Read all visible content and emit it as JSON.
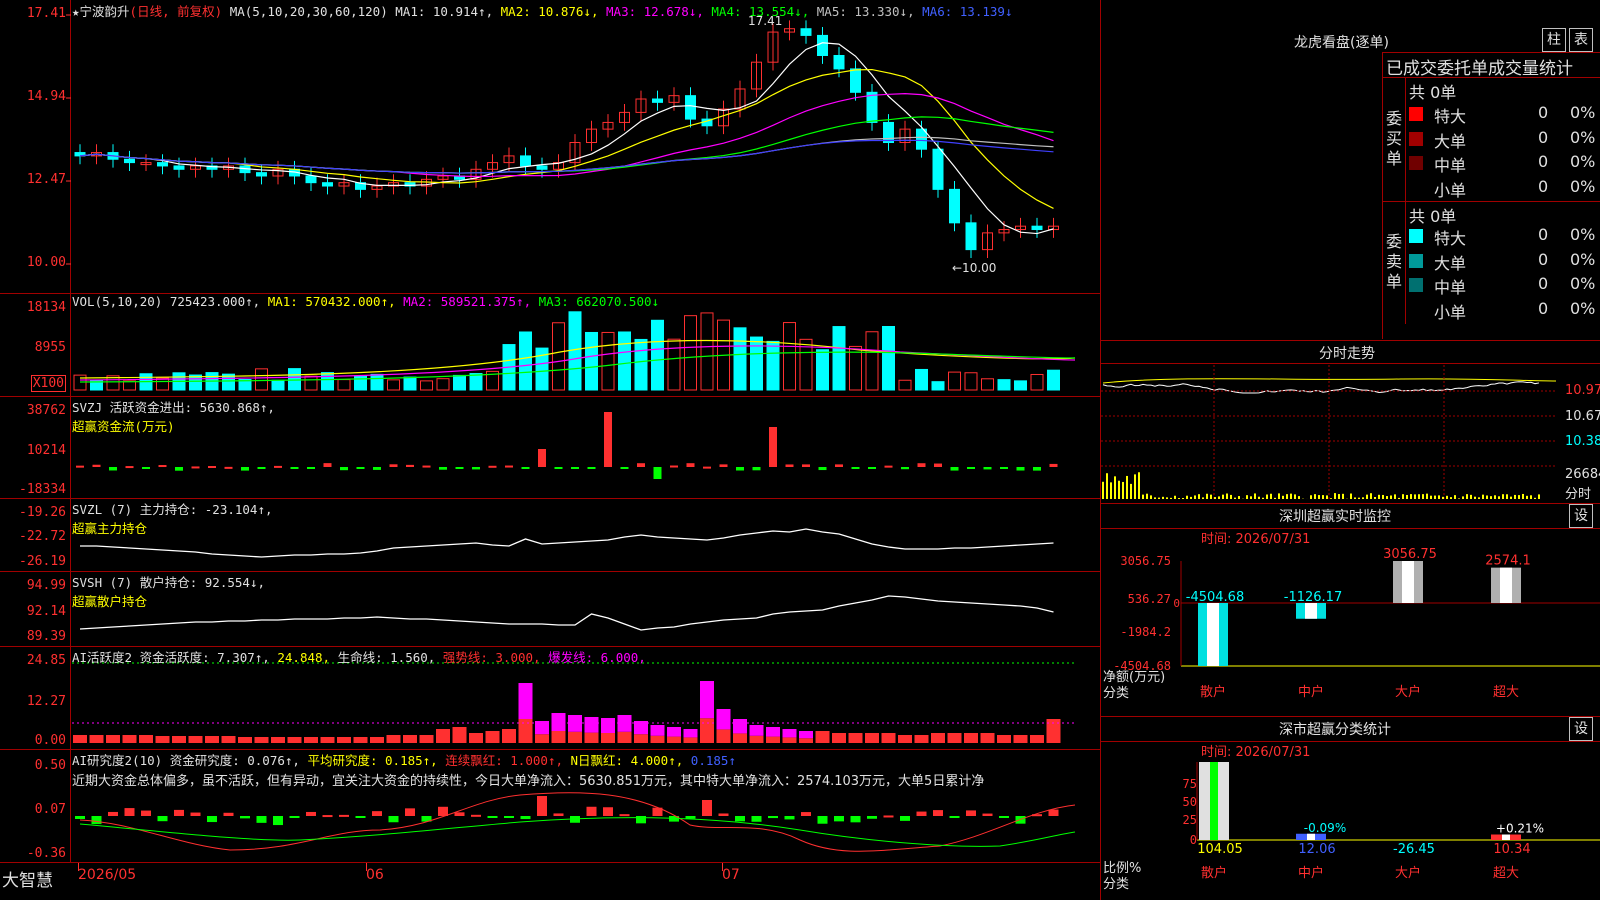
{
  "stock": {
    "star": "★",
    "name": "宁波韵升",
    "period": "(日线, 前复权)"
  },
  "main_head": {
    "ma_params": "MA(5,10,20,30,60,120)",
    "ma1": "MA1: 10.914↑,",
    "ma2": "MA2: 10.876↓,",
    "ma3": "MA3: 12.678↓,",
    "ma4": "MA4: 13.554↓,",
    "ma5": "MA5: 13.330↓,",
    "ma6": "MA6: 13.139↓"
  },
  "price_axis": [
    "17.41",
    "14.94",
    "12.47",
    "10.00"
  ],
  "price_marks": {
    "high": "17.41",
    "low": "←10.00"
  },
  "vol_head": {
    "params": "VOL(5,10,20)",
    "vol": "725423.000↑,",
    "ma1": "MA1: 570432.000↑,",
    "ma2": "MA2: 589521.375↑,",
    "ma3": "MA3: 662070.500↓"
  },
  "vol_axis": [
    "18134",
    "8955",
    "X100"
  ],
  "svzj_head": {
    "line1": "SVZJ  活跃资金进出: 5630.868↑,",
    "line2": "超赢资金流(万元)"
  },
  "svzj_axis": [
    "38762",
    "10214",
    "-18334"
  ],
  "svzl_head": {
    "line1": "SVZL (7) 主力持仓: -23.104↑,",
    "line2": "超赢主力持仓"
  },
  "svzl_axis": [
    "-19.26",
    "-22.72",
    "-26.19"
  ],
  "svsh_head": {
    "line1": "SVSH (7) 散户持仓: 92.554↓,",
    "line2": "超赢散户持仓"
  },
  "svsh_axis": [
    "94.99",
    "92.14",
    "89.39"
  ],
  "ai1_head": {
    "a": "AI活跃度2 资金活跃度: 7.307↑,",
    "b": "24.848,",
    "c": "生命线: 1.560,",
    "d": "强势线: 3.000,",
    "e": "爆发线: 6.000,"
  },
  "ai1_axis": [
    "24.85",
    "12.27",
    "0.00"
  ],
  "ai2_head": {
    "a": "AI研究度2(10) 资金研究度: 0.076↑,",
    "b": "平均研究度: 0.185↑,",
    "c": "连续飘红: 1.000↑,",
    "d": "N日飘红: 4.000↑,",
    "e": "0.185↑"
  },
  "ai2_comment": "近期大资金总体偏多，虽不活跃，但有异动，宜关注大资金的持续性，今日大单净流入：5630.851万元，其中特大单净流入：2574.103万元，大单5日累计净",
  "ai2_axis": [
    "0.50",
    "0.07",
    "-0.36"
  ],
  "bottom": {
    "brand": "大智慧",
    "d1": "2026/05",
    "d2": "06",
    "d3": "07"
  },
  "lhb": {
    "title": "龙虎看盘(逐单)",
    "btn1": "柱",
    "btn2": "表",
    "header": "已成交委托单成交量统计",
    "buy_label": "委买单",
    "sell_label": "委卖单",
    "buy_total": "共 0单",
    "sell_total": "共 0单",
    "buy_rows": [
      {
        "name": "特大",
        "val": "0",
        "pct": "0%",
        "color": "#ff0000"
      },
      {
        "name": "大单",
        "val": "0",
        "pct": "0%",
        "color": "#a00000"
      },
      {
        "name": "中单",
        "val": "0",
        "pct": "0%",
        "color": "#700000"
      },
      {
        "name": "小单",
        "val": "0",
        "pct": "0%",
        "color": ""
      }
    ],
    "sell_rows": [
      {
        "name": "特大",
        "val": "0",
        "pct": "0%",
        "color": "#00ffff"
      },
      {
        "name": "大单",
        "val": "0",
        "pct": "0%",
        "color": "#009a9a"
      },
      {
        "name": "中单",
        "val": "0",
        "pct": "0%",
        "color": "#007070"
      },
      {
        "name": "小单",
        "val": "0",
        "pct": "0%",
        "color": ""
      }
    ]
  },
  "intraday": {
    "title": "分时走势",
    "p1": "10.97",
    "p2": "10.67",
    "p3": "10.38",
    "vol": "26684",
    "vol_unit": "分时"
  },
  "sz_monitor": {
    "title": "深圳超赢实时监控",
    "btn": "设",
    "time": "时间: 2026/07/31",
    "axis": [
      "3056.75",
      "536.27",
      "-1984.2",
      "-4504.68"
    ],
    "zero": "0",
    "ylabel1": "净额(万元)",
    "ylabel2": "分类",
    "bars": [
      {
        "cat": "散户",
        "value": -4504.68,
        "label": "-4504.68"
      },
      {
        "cat": "中户",
        "value": -1126.17,
        "label": "-1126.17"
      },
      {
        "cat": "大户",
        "value": 3056.75,
        "label": "3056.75"
      },
      {
        "cat": "超大",
        "value": 2574.1,
        "label": "2574.1"
      }
    ]
  },
  "sz_class": {
    "title": "深市超赢分类统计",
    "btn": "设",
    "time": "时间: 2026/07/31",
    "axis": [
      "75",
      "50",
      "25",
      "0"
    ],
    "ylabel1": "比例%",
    "ylabel2": "分类",
    "bars": [
      {
        "cat": "散户",
        "pct": 75,
        "pct_label": "",
        "value": "104.05"
      },
      {
        "cat": "中户",
        "pct": 3,
        "pct_label": "-0.09%",
        "value": "12.06"
      },
      {
        "cat": "大户",
        "pct": 0,
        "pct_label": "",
        "value": "-26.45"
      },
      {
        "cat": "超大",
        "pct": 2,
        "pct_label": "+0.21%",
        "value": "10.34"
      }
    ]
  },
  "colors": {
    "up": "#ff3030",
    "down": "#00ffff",
    "grid": "#a00000",
    "ma1": "#ffffff",
    "ma2": "#ffff00",
    "ma3": "#ff00ff",
    "ma4": "#00ff00",
    "ma5": "#c0c0c0",
    "ma6": "#4040ff"
  }
}
